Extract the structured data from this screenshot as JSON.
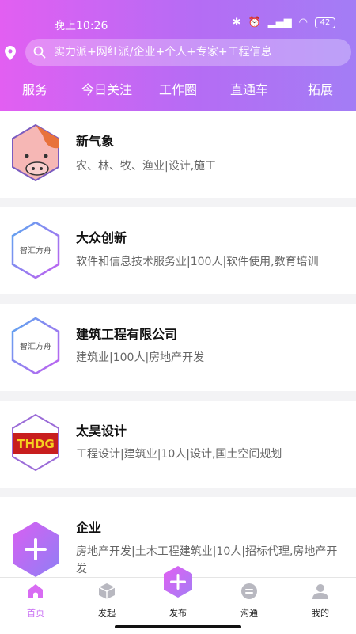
{
  "status": {
    "time": "晚上10:26",
    "battery": "42"
  },
  "search": {
    "placeholder": "实力派+网红派/企业+个人+专家+工程信息"
  },
  "nav": {
    "tabs": [
      "服务",
      "今日关注",
      "工作圈",
      "直通车",
      "拓展"
    ]
  },
  "cards": [
    {
      "title": "新气象",
      "desc": "农、林、牧、渔业|设计,施工",
      "logo": "pig-avatar"
    },
    {
      "title": "大众创新",
      "desc": "软件和信息技术服务业|100人|软件使用,教育培训",
      "logo_text": "智汇方舟"
    },
    {
      "title": "建筑工程有限公司",
      "desc": "建筑业|100人|房地产开发",
      "logo_text": "智汇方舟"
    },
    {
      "title": "太昊设计",
      "desc": "工程设计|建筑业|10人|设计,国土空间规划",
      "logo_text": "THDG"
    },
    {
      "title": "企业",
      "desc": "房地产开发|土木工程建筑业|10人|招标代理,房地产开发",
      "logo": "plus-hexagon"
    }
  ],
  "tabbar": {
    "items": [
      "首页",
      "发起",
      "发布",
      "沟通",
      "我的"
    ],
    "active": "首页"
  },
  "colors": {
    "accent": "#c86cf4",
    "header_start": "#e25ff2",
    "header_end": "#a37df5"
  }
}
